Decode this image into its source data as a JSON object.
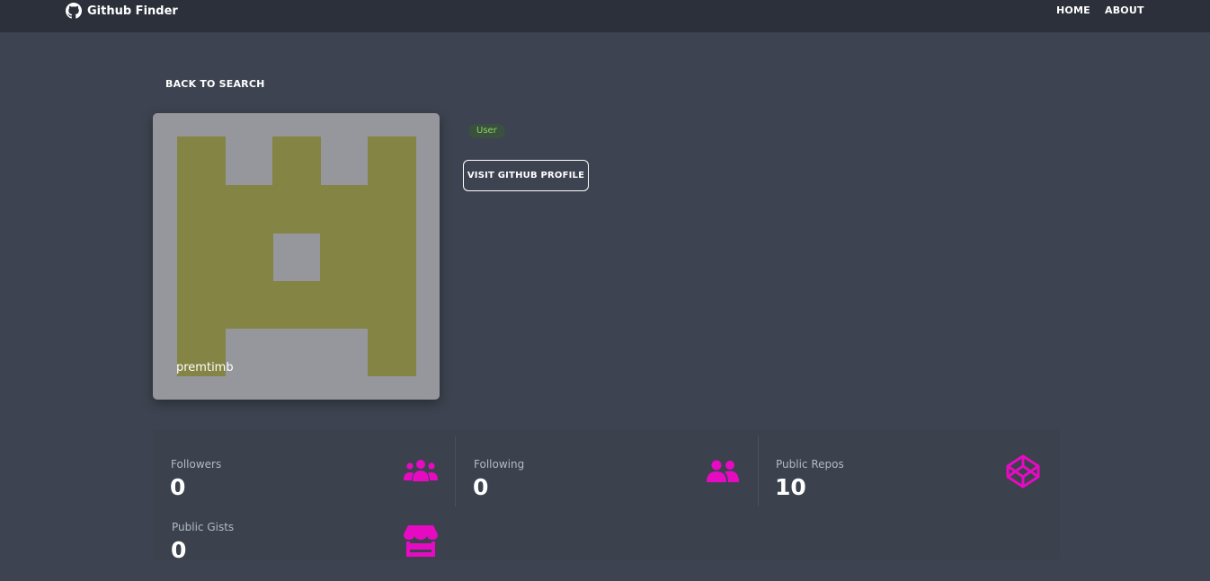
{
  "navbar": {
    "brand": "Github Finder",
    "brand_icon": "github-icon",
    "links": [
      "HOME",
      "ABOUT"
    ]
  },
  "back_button": "BACK TO SEARCH",
  "profile": {
    "username": "premtimb",
    "type_badge": "User",
    "visit_button": "VISIT GITHUB PROFILE"
  },
  "stats": [
    {
      "title": "Followers",
      "value": "0",
      "icon": "users-icon"
    },
    {
      "title": "Following",
      "value": "0",
      "icon": "user-friends-icon"
    },
    {
      "title": "Public Repos",
      "value": "10",
      "icon": "codepen-icon"
    },
    {
      "title": "Public Gists",
      "value": "0",
      "icon": "store-icon"
    }
  ],
  "colors": {
    "background": "#3d4350",
    "navbar": "#2b303a",
    "accent_icon": "#e60bc2",
    "badge_text": "#8ed35a",
    "avatar_bg": "#96979c",
    "avatar_fg": "#848444"
  }
}
